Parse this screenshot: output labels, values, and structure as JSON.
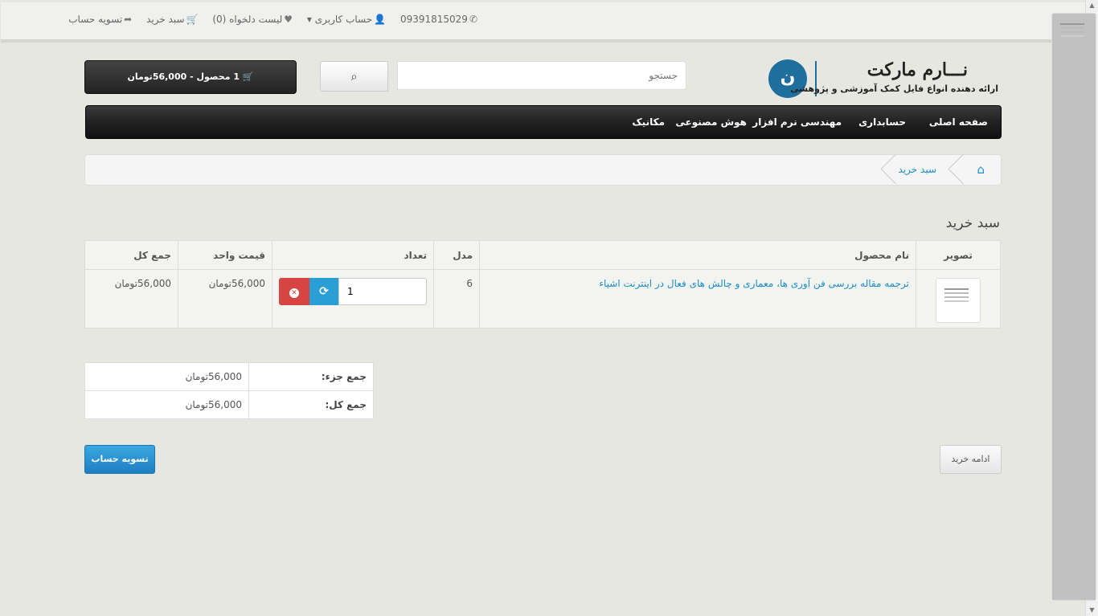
{
  "topbar": {
    "phone": "09391815029",
    "account": "حساب کاربری",
    "wishlist": "لیست دلخواه (0)",
    "cart": "سبد خرید",
    "checkout": "تسویه حساب"
  },
  "logo": {
    "title": "نـــارم مارکت",
    "tagline": "ارائه دهنده انواع فایل کمک آموزشی و پژوهشی"
  },
  "search": {
    "placeholder": "جستجو"
  },
  "cart_button": {
    "label": "1 محصول - 56,000تومان"
  },
  "menu": [
    "صفحه اصلی",
    "حسابداری",
    "مهندسی نرم افزار",
    "هوش مصنوعی",
    "مکانیک"
  ],
  "breadcrumb": {
    "current": "سبد خرید"
  },
  "page_title": "سبد خرید",
  "cart_table": {
    "headers": {
      "image": "تصویر",
      "name": "نام محصول",
      "model": "مدل",
      "quantity": "تعداد",
      "unit_price": "قیمت واحد",
      "total": "جمع کل"
    },
    "rows": [
      {
        "name": "ترجمه مقاله بررسی فن آوری ها، معماری و چالش های فعال در اینترنت اشیاء",
        "model": "6",
        "quantity": "1",
        "unit_price": "56,000تومان",
        "total": "56,000تومان"
      }
    ]
  },
  "totals": {
    "subtotal_label": "جمع جزء:",
    "subtotal_value": "56,000تومان",
    "total_label": "جمع کل:",
    "total_value": "56,000تومان"
  },
  "buttons": {
    "continue": "ادامه خرید",
    "checkout": "تسویه حساب"
  },
  "colors": {
    "accent": "#1a8ec9",
    "delete": "#d64541",
    "update": "#2a9fd6"
  }
}
